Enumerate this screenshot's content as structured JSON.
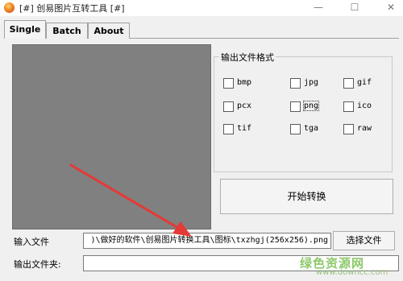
{
  "window": {
    "title": "[#] 创易图片互转工具 [#]",
    "controls": {
      "minimize": "—",
      "maximize": "☐",
      "close": "✕"
    }
  },
  "tabs": [
    {
      "label": "Single",
      "active": true
    },
    {
      "label": "Batch",
      "active": false
    },
    {
      "label": "About",
      "active": false
    }
  ],
  "output_format": {
    "group_label": "输出文件格式",
    "options": [
      {
        "label": "bmp",
        "checked": false
      },
      {
        "label": "jpg",
        "checked": false
      },
      {
        "label": "gif",
        "checked": false
      },
      {
        "label": "pcx",
        "checked": false
      },
      {
        "label": "png",
        "checked": false,
        "focused": true
      },
      {
        "label": "ico",
        "checked": false
      },
      {
        "label": "tif",
        "checked": false
      },
      {
        "label": "tga",
        "checked": false
      },
      {
        "label": "raw",
        "checked": false
      }
    ]
  },
  "start_button": "开始转换",
  "input": {
    "label": "输入文件",
    "value": ")\\做好的软件\\创易图片转换工具\\图标\\txzhgj(256x256).png",
    "browse": "选择文件"
  },
  "output": {
    "label": "输出文件夹:",
    "value": ""
  },
  "watermark": {
    "line1": "绿色资源网",
    "line2": "www.downcc.com"
  },
  "colors": {
    "preview_bg": "#808080",
    "arrow": "#e53935"
  }
}
